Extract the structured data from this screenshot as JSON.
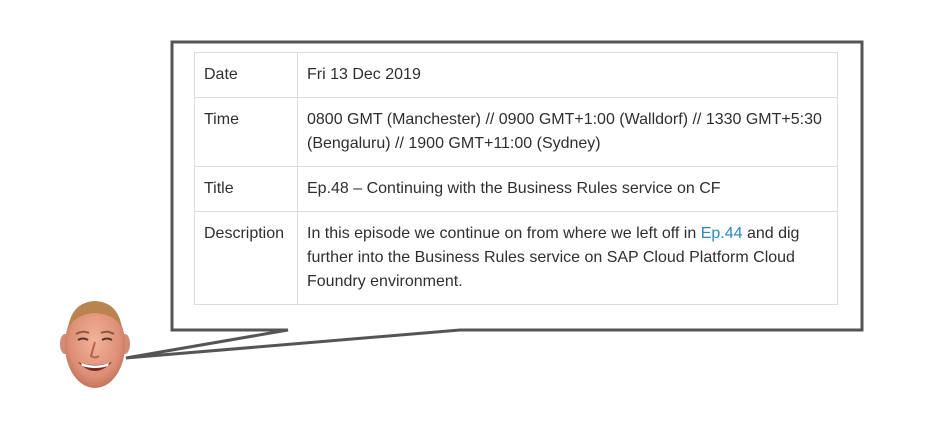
{
  "episode_details": {
    "rows": [
      {
        "label": "Date",
        "value": "Fri 13 Dec 2019"
      },
      {
        "label": "Time",
        "value": "0800 GMT (Manchester) // 0900 GMT+1:00 (Walldorf) // 1330 GMT+5:30 (Bengaluru) // 1900 GMT+11:00 (Sydney)"
      },
      {
        "label": "Title",
        "value": "Ep.48 – Continuing with the Business Rules service on CF"
      },
      {
        "label": "Description",
        "value_before_link": "In this episode we continue on from where we left off in ",
        "link_text": "Ep.44",
        "value_after_link": " and dig further into the Business Rules service on SAP Cloud Platform Cloud Foundry environment."
      }
    ]
  },
  "colors": {
    "link": "#2a87c5",
    "bubble_border": "#555555",
    "table_border": "#dcdcdc"
  },
  "icons": {
    "presenter": "presenter-face-avatar"
  }
}
